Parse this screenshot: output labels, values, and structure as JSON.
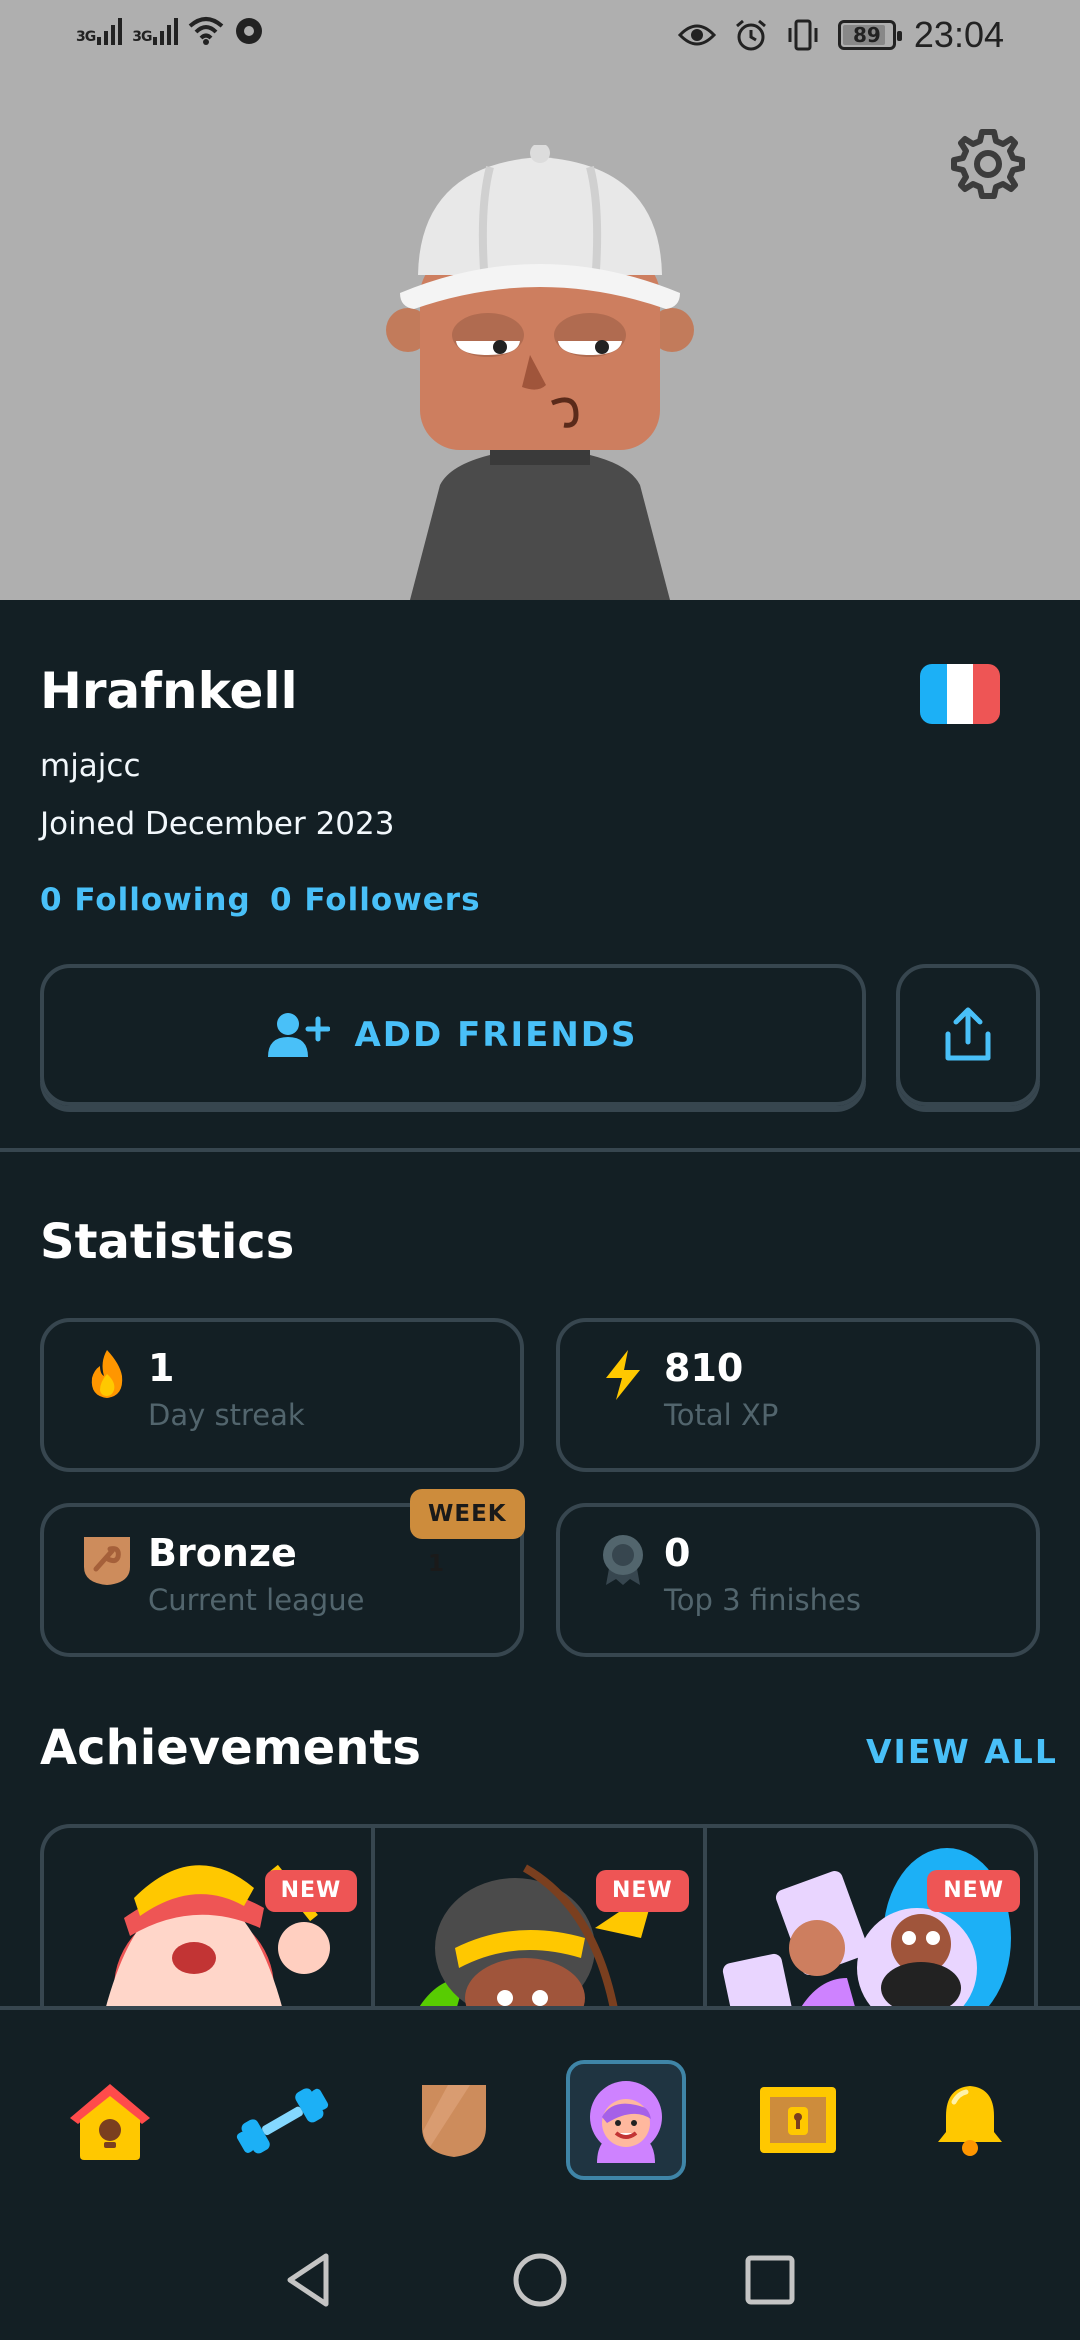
{
  "status_bar": {
    "network_1": "3G",
    "network_2": "3G",
    "battery": "89",
    "time": "23:04"
  },
  "header": {
    "settings_icon": "gear-icon",
    "background_color": "#afafaf"
  },
  "profile": {
    "display_name": "Hrafnkell",
    "username": "mjajcc",
    "joined": "Joined December 2023",
    "course_flag": "french-flag",
    "following": "0 Following",
    "followers": "0 Followers",
    "add_friends_label": "ADD FRIENDS",
    "share_icon": "share-icon"
  },
  "statistics": {
    "title": "Statistics",
    "cards": [
      {
        "icon": "fire-icon",
        "value": "1",
        "label": "Day streak"
      },
      {
        "icon": "lightning-icon",
        "value": "810",
        "label": "Total XP"
      },
      {
        "icon": "bronze-league-icon",
        "value": "Bronze",
        "label": "Current league",
        "badge": "WEEK 1"
      },
      {
        "icon": "medal-icon",
        "value": "0",
        "label": "Top 3 finishes"
      }
    ]
  },
  "achievements": {
    "title": "Achievements",
    "view_all": "VIEW ALL",
    "items": [
      {
        "badge": "NEW"
      },
      {
        "badge": "NEW"
      },
      {
        "badge": "NEW"
      }
    ]
  },
  "bottom_nav": {
    "items": [
      "home-icon",
      "practice-icon",
      "league-icon",
      "profile-icon",
      "shop-icon",
      "notifications-icon"
    ],
    "active": "profile-icon"
  },
  "colors": {
    "background": "#131f24",
    "accent_blue": "#49c0f8",
    "border": "#37464f",
    "new_badge": "#ee5555",
    "week_badge": "#cd8c3c"
  }
}
